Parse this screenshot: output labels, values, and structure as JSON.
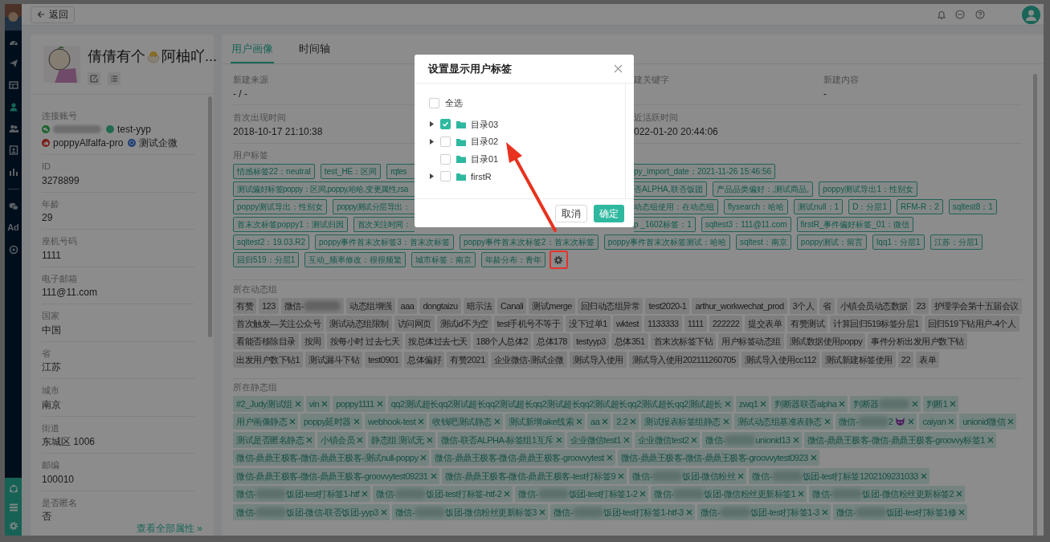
{
  "top_bar": {
    "back_label": "返回"
  },
  "sidebar": {
    "items": [
      {
        "kind": "gauge",
        "selected": false
      },
      {
        "kind": "send",
        "selected": false
      },
      {
        "kind": "layout",
        "selected": false
      },
      {
        "kind": "user",
        "selected": true
      },
      {
        "kind": "users",
        "selected": false
      },
      {
        "kind": "contact",
        "selected": false
      },
      {
        "kind": "chart",
        "selected": false
      },
      {
        "kind": "divider"
      },
      {
        "kind": "wechat",
        "selected": false
      },
      {
        "kind": "text",
        "label": "Ad",
        "selected": false
      },
      {
        "kind": "target",
        "selected": false
      }
    ],
    "bottom_items": [
      {
        "kind": "network"
      },
      {
        "kind": "list"
      },
      {
        "kind": "settings"
      }
    ]
  },
  "profile": {
    "name_start": "倩倩有个",
    "name_end": "阿柚吖...",
    "accounts_label": "连接账号",
    "accounts": [
      {
        "kind": "wechat",
        "blurred": true
      },
      {
        "kind": "dot",
        "name": "test-yyp"
      },
      {
        "kind": "thumb",
        "name": "poppyAlfalfa-pro"
      },
      {
        "kind": "work",
        "name": "测试企微"
      }
    ],
    "fields": [
      {
        "label": "ID",
        "value": "3278899"
      },
      {
        "label": "年龄",
        "value": "29"
      },
      {
        "label": "座机号码",
        "value": "1111"
      },
      {
        "label": "电子邮箱",
        "value": "111@11.com"
      },
      {
        "label": "国家",
        "value": "中国"
      },
      {
        "label": "省",
        "value": "江苏"
      },
      {
        "label": "城市",
        "value": "南京"
      },
      {
        "label": "街道",
        "value": "东城区 1006"
      },
      {
        "label": "邮编",
        "value": "100010"
      },
      {
        "label": "是否匿名",
        "value": "否"
      }
    ],
    "more_link": "查看全部属性 »"
  },
  "tabs": [
    {
      "label": "用户画像",
      "selected": true
    },
    {
      "label": "时间轴",
      "selected": false
    }
  ],
  "info_rows": [
    [
      {
        "label": "新建来源",
        "value": "- / -"
      },
      {
        "label": "建关键字"
      },
      {
        "label": "新建内容",
        "value": "-"
      }
    ],
    [
      {
        "label": "首次出现时间",
        "value": "2018-10-17 21:10:38"
      },
      {
        "label": "近活跃时间",
        "value": "022-01-20 20:44:06"
      },
      null
    ]
  ],
  "user_tags": {
    "label": "用户标签",
    "lines": [
      {
        "tags": [
          {
            "text": "情感标签22：neutral"
          },
          {
            "text": "test_HE：区间"
          },
          {
            "text": "rqtes",
            "cut_right": true
          },
          {
            "text": "py_import_date：2021-11-26 15:46:56",
            "cut_left": true
          }
        ]
      },
      {
        "tags": [
          {
            "text": "测试偏好标签poppy：区间,poppy,哈哈,变更属性,rsa",
            "cut_right": true
          },
          {
            "text": "否ALPHA,联否饭团",
            "cut_left": true
          },
          {
            "text": "产品品类偏好：,测试商品,"
          },
          {
            "text": "poppy测试导出1：性别女"
          }
        ]
      },
      {
        "tags": [
          {
            "text": "poppy测试导出：性别女"
          },
          {
            "text": "poppy测试分层导出：",
            "cut_right": true
          },
          {
            "text": "动态组使用：在动态组",
            "cut_left": true
          },
          {
            "text": "flysearch：哈哈"
          },
          {
            "text": "测试null：1"
          },
          {
            "text": "D：分层1"
          },
          {
            "text": "RFM-R：2"
          },
          {
            "text": "sqltest8：1"
          }
        ]
      },
      {
        "tags": [
          {
            "text": "首末次标签poppy1：测试归因"
          },
          {
            "text": "首次关注时间：",
            "cut_right": true
          },
          {
            "text": "p _1602标签：1",
            "cut_left": true
          },
          {
            "text": "sqltest3：111@11.com"
          },
          {
            "text": "firstR_事件偏好标签_01：微信"
          }
        ]
      },
      {
        "tags": [
          {
            "text": "sqltest2：19.03.R2"
          },
          {
            "text": "poppy事件首末次标签3：首末次标签"
          },
          {
            "text": "poppy事件首末次标签2：首末次标签"
          },
          {
            "text": "poppy事件首末次标签测试：哈哈"
          },
          {
            "text": "sqltest：南京"
          },
          {
            "text": "poppy测试：留言"
          },
          {
            "text": "lqq1：分层1"
          },
          {
            "text": "江苏：分层1"
          }
        ]
      },
      {
        "tags": [
          {
            "text": "回归519：分层1"
          },
          {
            "text": "互动_频率修改：很很频繁"
          },
          {
            "text": "城市标签：南京"
          },
          {
            "text": "年龄分布：青年"
          }
        ]
      }
    ]
  },
  "dynamic_groups": {
    "label": "所在动态组",
    "tags": [
      {
        "text": "有赞"
      },
      {
        "text": "123"
      },
      {
        "text": "微信-",
        "blurred": true
      },
      {
        "text": "动态组增强"
      },
      {
        "text": "aaa"
      },
      {
        "text": "dongtaizu"
      },
      {
        "text": "暗示法"
      },
      {
        "text": "Canali"
      },
      {
        "text": "测试merge"
      },
      {
        "text": "回归动态组异常"
      },
      {
        "text": "test2020-1"
      },
      {
        "text": "arthur_workwechat_prod"
      },
      {
        "text": "3个人"
      },
      {
        "text": "省"
      },
      {
        "text": "小镇会员动态数据"
      },
      {
        "text": "23"
      },
      {
        "text": "护理学会第十五届会议"
      },
      {
        "text": "首次触发—关注公众号"
      },
      {
        "text": "测试动态组限制"
      },
      {
        "text": "访问网页"
      },
      {
        "text": "测试id不为空"
      },
      {
        "text": "test手机号不等于"
      },
      {
        "text": "没下过单1"
      },
      {
        "text": "wktest"
      },
      {
        "text": "1133333"
      },
      {
        "text": "1111"
      },
      {
        "text": "222222"
      },
      {
        "text": "提交表单"
      },
      {
        "text": "有赞测试"
      },
      {
        "text": "计算回归519标签分层1"
      },
      {
        "text": "回归519下钻用户-4个人"
      },
      {
        "text": "看能否移除目录"
      },
      {
        "text": "按周"
      },
      {
        "text": "按每小时 过去七天"
      },
      {
        "text": "按总体过去七天"
      },
      {
        "text": "188个人总体2"
      },
      {
        "text": "总体178"
      },
      {
        "text": "testyyp3"
      },
      {
        "text": "总体351"
      },
      {
        "text": "首末次标签下钻"
      },
      {
        "text": "用户标签动态组"
      },
      {
        "text": "测试数据使用poppy"
      },
      {
        "text": "事件分析出发用户数下钻"
      },
      {
        "text": "出发用户数下钻1"
      },
      {
        "text": "测试漏斗下钻"
      },
      {
        "text": "test0901"
      },
      {
        "text": "总体偏好"
      },
      {
        "text": "有赞2021"
      },
      {
        "text": "企业微信-测试企微"
      },
      {
        "text": "测试导入使用"
      },
      {
        "text": "测试导入使用202111260705"
      },
      {
        "text": "测试导入使用cc112"
      },
      {
        "text": "测试新建标签使用"
      },
      {
        "text": "22"
      },
      {
        "text": "表单"
      }
    ]
  },
  "static_groups": {
    "label": "所在静态组",
    "tags": [
      {
        "text": "#2_Judy测试组"
      },
      {
        "text": "vin"
      },
      {
        "text": "poppy1111"
      },
      {
        "text": "qq2测试超长qq2测试超长qq2测试超长qq2测试超长qq2测试超长qq2测试超长qq2测试超长"
      },
      {
        "text": "zwq1"
      },
      {
        "text": "判断器联否alpha"
      },
      {
        "text": "判断器",
        "blurred": true
      },
      {
        "text": "判断1"
      },
      {
        "text": "用户画像静态"
      },
      {
        "text": "poppy延时器"
      },
      {
        "text": "webhook-test"
      },
      {
        "text": "收钱吧测试静态"
      },
      {
        "text": "测试新增aike线索"
      },
      {
        "text": "aa"
      },
      {
        "text": "2.2"
      },
      {
        "text": "测试报表标签组静态"
      },
      {
        "text": "测试动态组基准表静态"
      },
      {
        "text": "微信-",
        "blurred": true,
        "tail": "2",
        "trailing_icon": true
      },
      {
        "text": "caiyan"
      },
      {
        "text": "unionid微信"
      },
      {
        "text": "测试是否匿名静态"
      },
      {
        "text": "小镇会员"
      },
      {
        "text": "静态组 测试无"
      },
      {
        "text": "微信-联否ALPHA-标签组1互斥"
      },
      {
        "text": "企业微信test1"
      },
      {
        "text": "企业微信test2"
      },
      {
        "text": "微信-",
        "blurred": true,
        "tail": "unionid13"
      },
      {
        "text": "微信-鼎鼎王极客-微信-鼎鼎王极客-groovvy标签1"
      },
      {
        "text": "微信-鼎鼎王极客-微信-鼎鼎王极客-测试null-poppy"
      },
      {
        "text": "微信-鼎鼎王极客-微信-鼎鼎王极客-groovvytest"
      },
      {
        "text": "微信-鼎鼎王极客-微信-鼎鼎王极客-groovvytest0923"
      },
      {
        "text": "微信-鼎鼎王极客-微信-鼎鼎王极客-groovvytest09231"
      },
      {
        "text": "微信-鼎鼎王极客-微信-鼎鼎王极客-test打标签9"
      },
      {
        "text": "微信-",
        "blurred": true,
        "tail": "饭团-微信粉丝"
      },
      {
        "text": "微信-",
        "blurred": true,
        "tail": "饭团-test打标签1202109231033"
      },
      {
        "text": "微信-",
        "blurred": true,
        "tail": "饭团-test打标签1-htf"
      },
      {
        "text": "微信-",
        "blurred": true,
        "tail": "饭团-test打标签-htf-2"
      },
      {
        "text": "微信-",
        "blurred": true,
        "tail": "饭团-test打标签1-2"
      },
      {
        "text": "微信-",
        "blurred": true,
        "tail": "饭团-微信粉丝更新标签1"
      },
      {
        "text": "微信-",
        "blurred": true,
        "tail": "饭团-微信粉丝更新标签2"
      },
      {
        "text": "微信-",
        "blurred": true,
        "tail": "饭团-微信-联否饭团-yyp3"
      },
      {
        "text": "微信-",
        "blurred": true,
        "tail": "饭团-微信粉丝更新标签3"
      },
      {
        "text": "微信-",
        "blurred": true,
        "tail": "饭团-test打标签1-htf-3"
      },
      {
        "text": "微信-",
        "blurred": true,
        "tail": "饭团-test打标签1-3"
      },
      {
        "text": "微信-",
        "blurred": true,
        "tail": "饭团-test打标签1修"
      }
    ]
  },
  "modal": {
    "title": "设置显示用户标签",
    "select_all": {
      "label": "全选",
      "checked": false
    },
    "tree": [
      {
        "label": "目录03",
        "checked": true,
        "expanded": false,
        "has_children": true
      },
      {
        "label": "目录02",
        "checked": false,
        "expanded": false,
        "has_children": true
      },
      {
        "label": "目录01",
        "checked": false,
        "has_children": false
      },
      {
        "label": "firstR",
        "checked": false,
        "expanded": false,
        "has_children": true
      }
    ],
    "buttons": [
      {
        "label": "取消",
        "kind": "secondary"
      },
      {
        "label": "确定",
        "kind": "primary"
      }
    ]
  }
}
